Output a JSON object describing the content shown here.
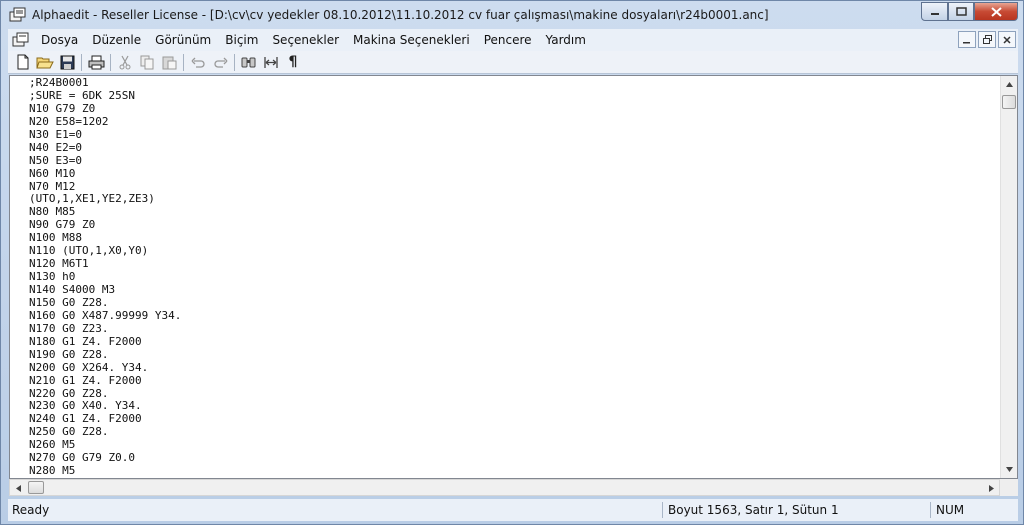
{
  "window": {
    "title": "Alphaedit - Reseller License - [D:\\cv\\cv yedekler 08.10.2012\\11.10.2012 cv fuar çalışması\\makine dosyaları\\r24b0001.anc]",
    "buttons": [
      "minimize-icon",
      "maximize-icon",
      "close-icon"
    ]
  },
  "menu": {
    "items": [
      "Dosya",
      "Düzenle",
      "Görünüm",
      "Biçim",
      "Seçenekler",
      "Makina Seçenekleri",
      "Pencere",
      "Yardım"
    ]
  },
  "toolbar": {
    "icons": [
      "new-file-icon",
      "open-folder-icon",
      "save-icon",
      "print-icon",
      "cut-icon",
      "copy-icon",
      "paste-icon",
      "undo-icon",
      "redo-icon",
      "find-icon",
      "replace-icon",
      "pilcrow-icon"
    ],
    "pilcrow": "¶"
  },
  "editor": {
    "lines": [
      ";R24B0001",
      ";SURE = 6DK 25SN",
      "N10 G79 Z0",
      "N20 E58=1202",
      "N30 E1=0",
      "N40 E2=0",
      "N50 E3=0",
      "N60 M10",
      "N70 M12",
      "(UTO,1,XE1,YE2,ZE3)",
      "N80 M85",
      "N90 G79 Z0",
      "N100 M88",
      "N110 (UTO,1,X0,Y0)",
      "N120 M6T1",
      "N130 h0",
      "N140 S4000 M3",
      "N150 G0 Z28.",
      "N160 G0 X487.99999 Y34.",
      "N170 G0 Z23.",
      "N180 G1 Z4. F2000",
      "N190 G0 Z28.",
      "N200 G0 X264. Y34.",
      "N210 G1 Z4. F2000",
      "N220 G0 Z28.",
      "N230 G0 X40. Y34.",
      "N240 G1 Z4. F2000",
      "N250 G0 Z28.",
      "N260 M5",
      "N270 G0 G79 Z0.0",
      "N280 M5"
    ]
  },
  "status": {
    "ready": "Ready",
    "position": "Boyut 1563, Satır 1, Sütun 1",
    "num": "NUM"
  }
}
